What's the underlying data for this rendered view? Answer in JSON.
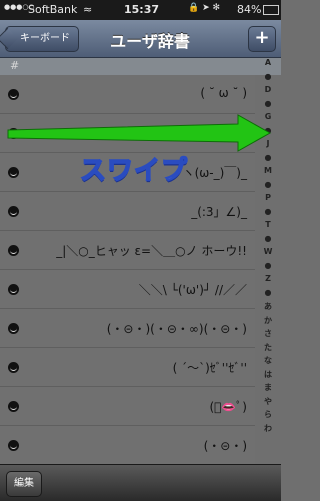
{
  "statusbar": {
    "signal": "●●●○○",
    "carrier": "SoftBank",
    "wifi": "≈",
    "time": "15:37",
    "icons": "🔒 ➤ ✻",
    "battery": "84%"
  },
  "navbar": {
    "back_label": "キーボード",
    "title": "ユーザ辞書",
    "add_label": "+"
  },
  "section": {
    "label": "#"
  },
  "rows": [
    {
      "text": "( ˘ ω ˘ )"
    },
    {
      "text": "(ᵔ ◡ ᵔ)"
    },
    {
      "text": "ヽ(ω-_)￣)_"
    },
    {
      "text": "_(:3」∠)_"
    },
    {
      "text": "_|＼○_ヒャッ ε=＼＿○ノ ホーウ!!"
    },
    {
      "text": "＼＼\\ └('ω')┘ //／／"
    },
    {
      "text": "(・⊝・)(・⊝・∞)(・⊝・)"
    },
    {
      "text": "( ´〜`)ｾﾞ''ｾﾞ''"
    },
    {
      "text": "(ﾟ👄ﾟ)"
    },
    {
      "text": "(・⊝・)"
    }
  ],
  "index": [
    "A",
    "●",
    "D",
    "●",
    "G",
    "●",
    "J",
    "●",
    "M",
    "●",
    "P",
    "●",
    "T",
    "●",
    "W",
    "●",
    "Z",
    "●",
    "あ",
    "か",
    "さ",
    "た",
    "な",
    "は",
    "ま",
    "や",
    "ら",
    "わ"
  ],
  "toolbar": {
    "edit_label": "編集"
  },
  "overlay": {
    "swipe_text": "スワイプ"
  },
  "colors": {
    "arrow": "#22c414",
    "swipe_text_outline": "#2a4cc0"
  }
}
